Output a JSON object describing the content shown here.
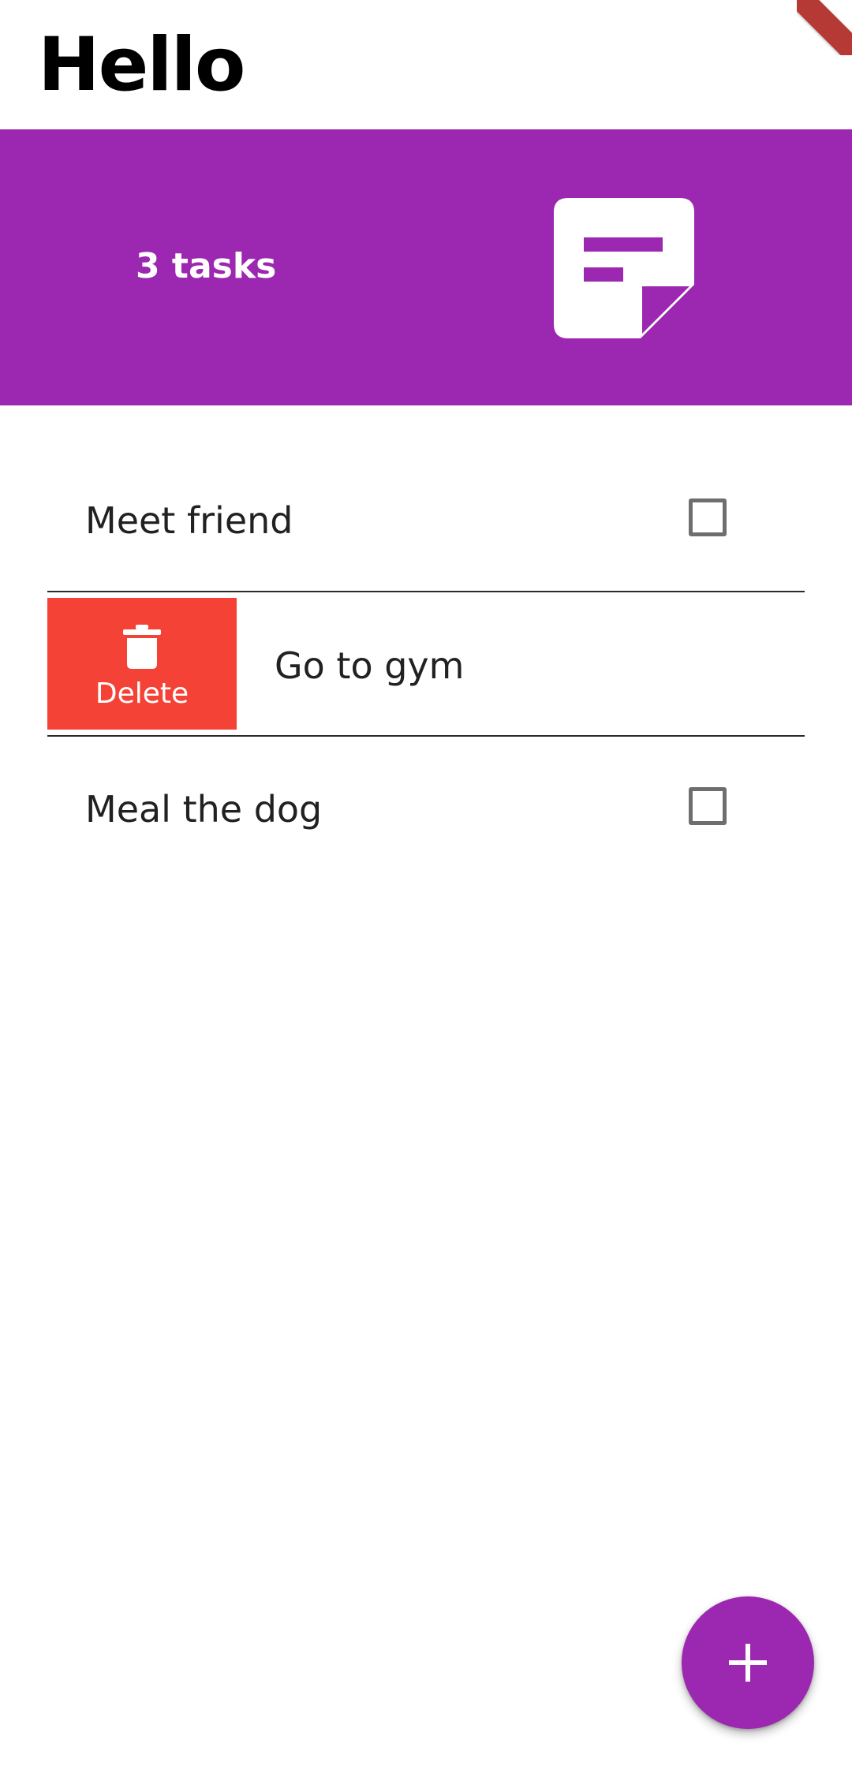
{
  "header": {
    "greeting": "Hello"
  },
  "summary": {
    "task_count_label": "3 tasks",
    "icon": "sticky-note-icon"
  },
  "tasks": [
    {
      "title": "Meet friend",
      "checked": false
    },
    {
      "title": "Go to gym",
      "checked": false,
      "swiped": true
    },
    {
      "title": "Meal the dog",
      "checked": false
    }
  ],
  "swipe_action": {
    "label": "Delete",
    "icon": "trash-icon"
  },
  "fab": {
    "icon": "plus-icon"
  },
  "colors": {
    "primary": "#9c27b0",
    "delete": "#f44336",
    "text": "#212121",
    "checkbox_border": "#6e6e6e"
  }
}
